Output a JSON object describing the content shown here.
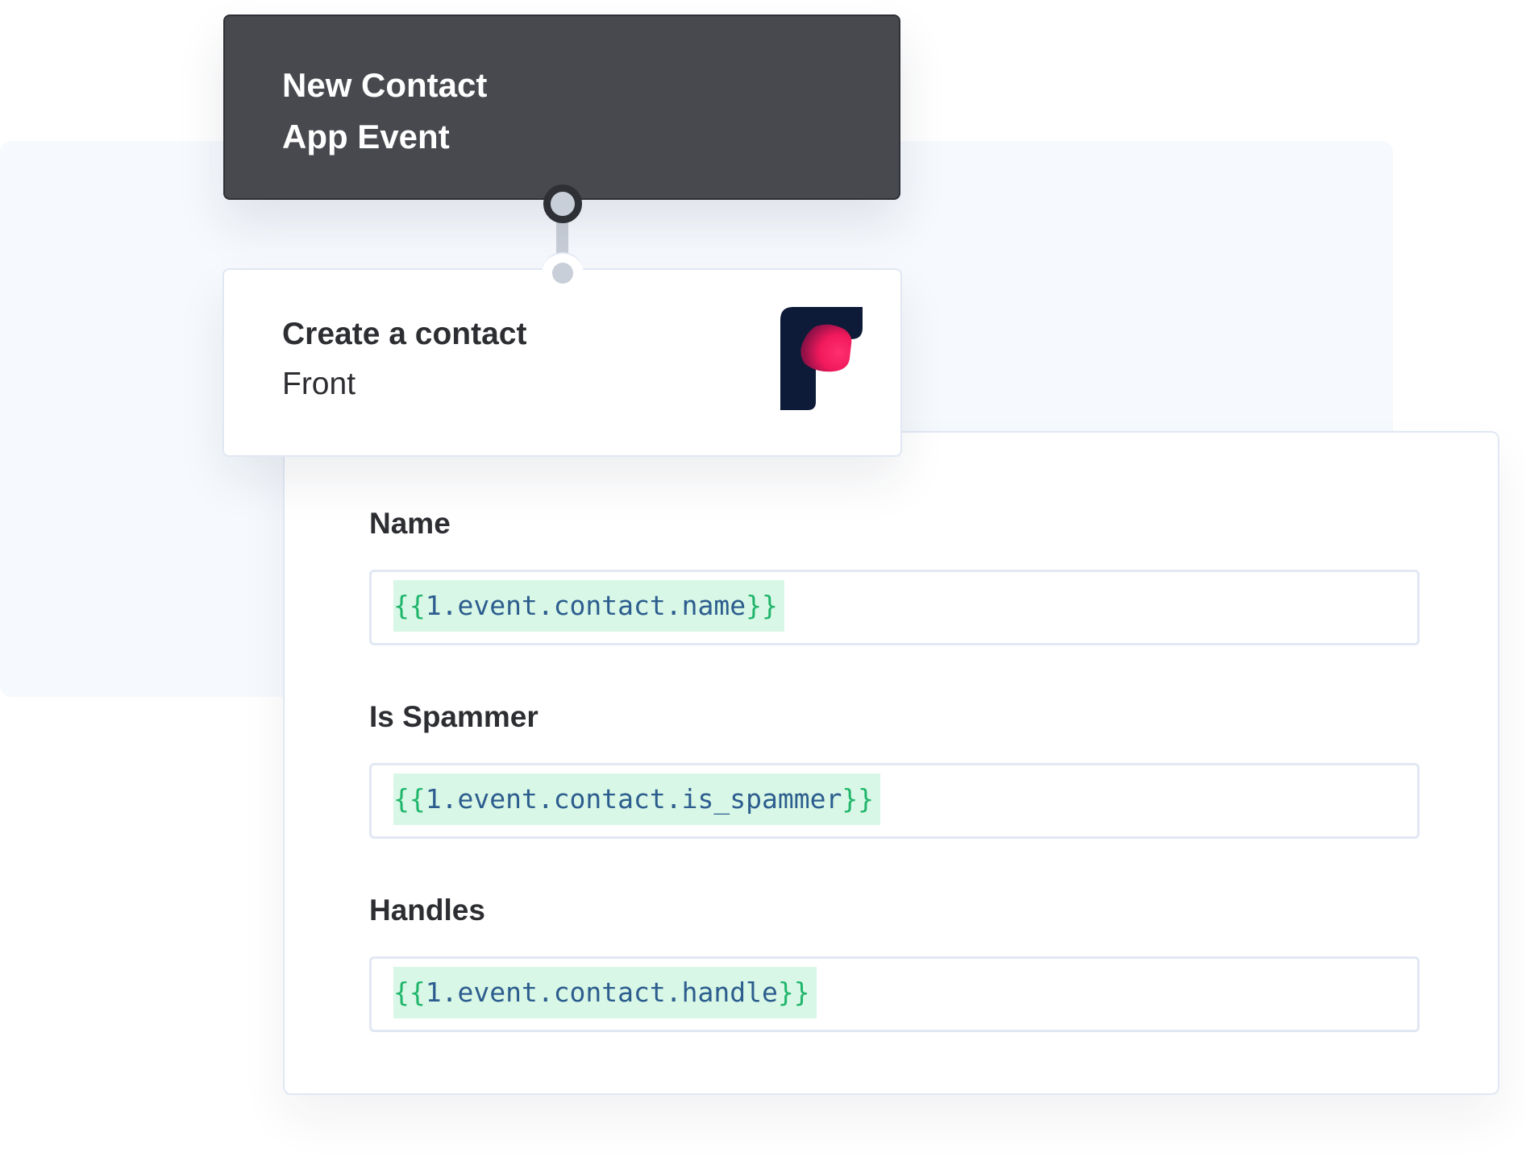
{
  "trigger": {
    "line1": "New Contact",
    "line2": "App Event",
    "background_color": "#47494e"
  },
  "action": {
    "title": "Create a contact",
    "app": "Front",
    "logo_icon": "front-logo-icon",
    "logo_colors": {
      "shape": "#0d1b38",
      "accent": "#f0195c"
    }
  },
  "form": {
    "fields": [
      {
        "label": "Name",
        "token_open": "{{",
        "token_path": "1.event.contact.name",
        "token_close": "}}"
      },
      {
        "label": "Is Spammer",
        "token_open": "{{",
        "token_path": "1.event.contact.is_spammer",
        "token_close": "}}"
      },
      {
        "label": "Handles",
        "token_open": "{{",
        "token_path": "1.event.contact.handle",
        "token_close": "}}"
      }
    ],
    "token_colors": {
      "background": "#d8f7e6",
      "brace": "#1fb56a",
      "path": "#2c5d8e"
    }
  }
}
